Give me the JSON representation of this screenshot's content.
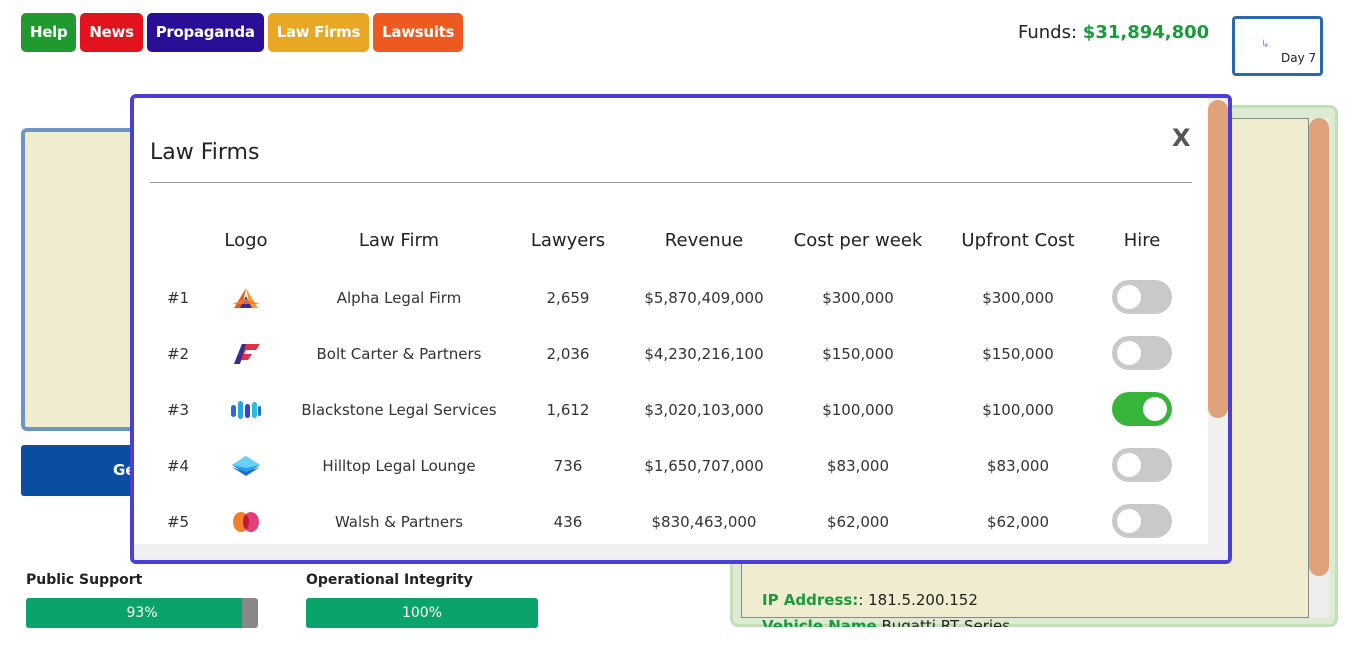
{
  "nav": {
    "items": [
      {
        "label": "Help",
        "color": "#1e9a2e"
      },
      {
        "label": "News",
        "color": "#e3121f"
      },
      {
        "label": "Propaganda",
        "color": "#2a0f96"
      },
      {
        "label": "Law Firms",
        "color": "#e8a823"
      },
      {
        "label": "Lawsuits",
        "color": "#ec5a1f"
      }
    ]
  },
  "funds": {
    "label": "Funds:",
    "value": "$31,894,800"
  },
  "day": {
    "label": "Day 7"
  },
  "background": {
    "left_button_label": "Ge",
    "ip_key": "IP Address:",
    "ip_sep": ": ",
    "ip_value": "181.5.200.152",
    "vehicle_key": "Vehicle Name",
    "vehicle_value": "Bugatti RT Series"
  },
  "meters": {
    "public_support": {
      "label": "Public Support",
      "value": "93%",
      "fraction": 0.93
    },
    "operational_integrity": {
      "label": "Operational Integrity",
      "value": "100%",
      "fraction": 1.0
    }
  },
  "modal": {
    "title": "Law Firms",
    "close_label": "X",
    "columns": {
      "logo": "Logo",
      "firm": "Law Firm",
      "lawyers": "Lawyers",
      "revenue": "Revenue",
      "cost": "Cost per week",
      "upfront": "Upfront Cost",
      "hire": "Hire"
    },
    "rows": [
      {
        "rank": "#1",
        "logo": "alpha-logo-icon",
        "firm": "Alpha Legal Firm",
        "lawyers": "2,659",
        "revenue": "$5,870,409,000",
        "cost": "$300,000",
        "upfront": "$300,000",
        "hired": false
      },
      {
        "rank": "#2",
        "logo": "bolt-logo-icon",
        "firm": "Bolt Carter & Partners",
        "lawyers": "2,036",
        "revenue": "$4,230,216,100",
        "cost": "$150,000",
        "upfront": "$150,000",
        "hired": false
      },
      {
        "rank": "#3",
        "logo": "blackstone-logo-icon",
        "firm": "Blackstone Legal Services",
        "lawyers": "1,612",
        "revenue": "$3,020,103,000",
        "cost": "$100,000",
        "upfront": "$100,000",
        "hired": true
      },
      {
        "rank": "#4",
        "logo": "hilltop-logo-icon",
        "firm": "Hilltop Legal Lounge",
        "lawyers": "736",
        "revenue": "$1,650,707,000",
        "cost": "$83,000",
        "upfront": "$83,000",
        "hired": false
      },
      {
        "rank": "#5",
        "logo": "walsh-logo-icon",
        "firm": "Walsh & Partners",
        "lawyers": "436",
        "revenue": "$830,463,000",
        "cost": "$62,000",
        "upfront": "$62,000",
        "hired": false
      }
    ]
  }
}
